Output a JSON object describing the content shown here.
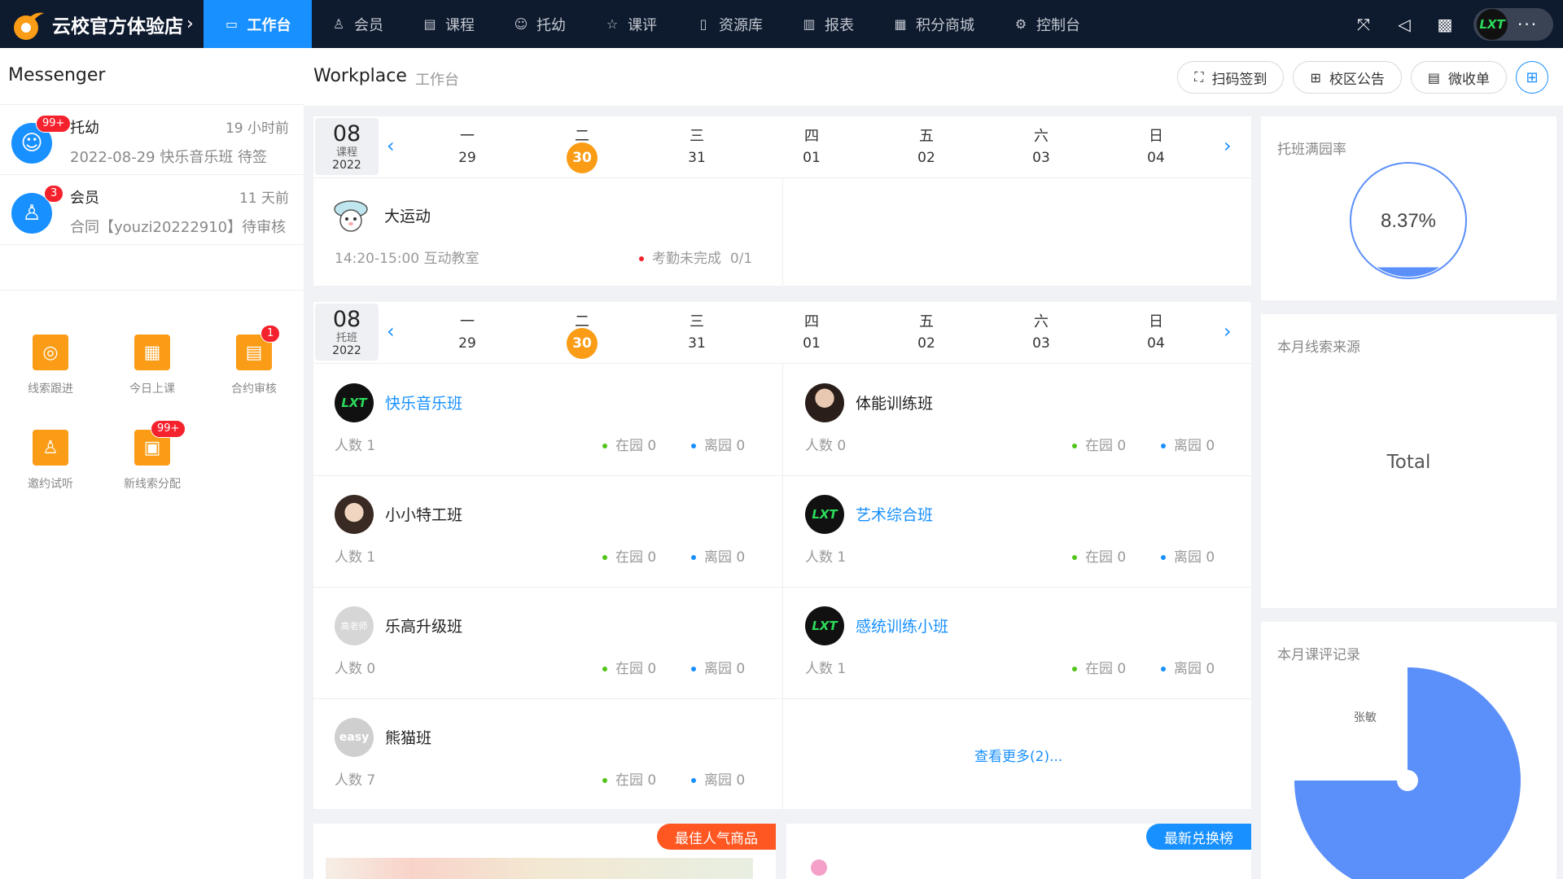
{
  "brand": {
    "name": "云校官方体验店"
  },
  "nav": {
    "items": [
      {
        "label": "工作台"
      },
      {
        "label": "会员"
      },
      {
        "label": "课程"
      },
      {
        "label": "托幼"
      },
      {
        "label": "课评"
      },
      {
        "label": "资源库"
      },
      {
        "label": "报表"
      },
      {
        "label": "积分商城"
      },
      {
        "label": "控制台"
      }
    ]
  },
  "user": {
    "logo_text": "LXT"
  },
  "sidebar": {
    "title": "Messenger",
    "messages": [
      {
        "title": "托幼",
        "time": "19 小时前",
        "body": "2022-08-29 快乐音乐班 待签",
        "badge": "99+"
      },
      {
        "title": "会员",
        "time": "11 天前",
        "body": "合同【youzi20222910】待审核",
        "badge": "3"
      }
    ],
    "quick": [
      {
        "label": "线索跟进",
        "badge": ""
      },
      {
        "label": "今日上课",
        "badge": ""
      },
      {
        "label": "合约审核",
        "badge": "1"
      },
      {
        "label": "邀约试听",
        "badge": ""
      },
      {
        "label": "新线索分配",
        "badge": "99+"
      }
    ]
  },
  "header": {
    "title": "Workplace",
    "subtitle": "工作台",
    "buttons": [
      {
        "label": "扫码签到"
      },
      {
        "label": "校区公告"
      },
      {
        "label": "微收单"
      }
    ]
  },
  "week": {
    "month": "08",
    "year": "2022",
    "days": [
      {
        "w": "一",
        "n": "29"
      },
      {
        "w": "二",
        "n": "30"
      },
      {
        "w": "三",
        "n": "31"
      },
      {
        "w": "四",
        "n": "01"
      },
      {
        "w": "五",
        "n": "02"
      },
      {
        "w": "六",
        "n": "03"
      },
      {
        "w": "日",
        "n": "04"
      }
    ]
  },
  "course_card": {
    "type_label": "课程",
    "item": {
      "name": "大运动",
      "time_room": "14:20-15:00 互动教室",
      "status": "考勤未完成",
      "count": "0/1"
    }
  },
  "class_card": {
    "type_label": "托班",
    "classes": [
      {
        "name": "快乐音乐班",
        "people": "人数 1",
        "in": "在园 0",
        "out": "离园 0"
      },
      {
        "name": "体能训练班",
        "people": "人数 0",
        "in": "在园 0",
        "out": "离园 0"
      },
      {
        "name": "小小特工班",
        "people": "人数 1",
        "in": "在园 0",
        "out": "离园 0"
      },
      {
        "name": "艺术综合班",
        "people": "人数 1",
        "in": "在园 0",
        "out": "离园 0"
      },
      {
        "name": "乐高升级班",
        "people": "人数 0",
        "in": "在园 0",
        "out": "离园 0"
      },
      {
        "name": "感统训练小班",
        "people": "人数 1",
        "in": "在园 0",
        "out": "离园 0"
      },
      {
        "name": "熊猫班",
        "people": "人数 7",
        "in": "在园 0",
        "out": "离园 0"
      }
    ],
    "avatar_text": {
      "gao": "高老师",
      "easy": "easy"
    },
    "more": "查看更多(2)..."
  },
  "promo": {
    "left": "最佳人气商品",
    "right": "最新兑换榜"
  },
  "right": {
    "occupancy": {
      "title": "托班满园率",
      "value": "8.37%",
      "fraction": 0.0837
    },
    "source": {
      "title": "本月线索来源",
      "total_label": "Total"
    },
    "reviews": {
      "title": "本月课评记录",
      "slice_label": "张敏"
    }
  },
  "colors": {
    "topbar": "#0e1a2e",
    "accent": "#1890ff",
    "orange": "#fa9c15",
    "pie": "#5b8ff9"
  }
}
